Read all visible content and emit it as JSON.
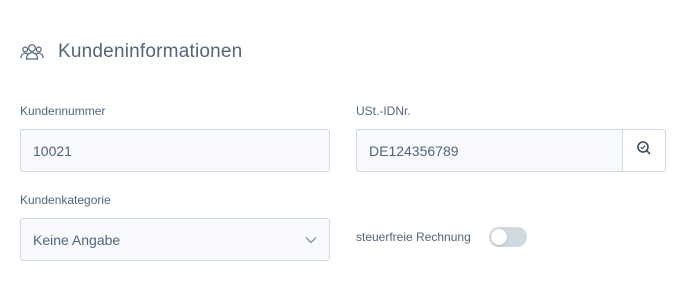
{
  "section": {
    "title": "Kundeninformationen",
    "icon": "users-icon"
  },
  "fields": {
    "customer_number": {
      "label": "Kundennummer",
      "value": "10021"
    },
    "vat_id": {
      "label": "USt.-IDNr.",
      "value": "DE124356789"
    },
    "customer_category": {
      "label": "Kundenkategorie",
      "value": "Keine Angabe"
    },
    "tax_free_invoice": {
      "label": "steuerfreie Rechnung",
      "checked": false
    }
  },
  "colors": {
    "text": "#52667a",
    "field_bg": "#f8f9fc",
    "border": "#d1d9e0",
    "toggle_off": "#d1d9e0"
  }
}
